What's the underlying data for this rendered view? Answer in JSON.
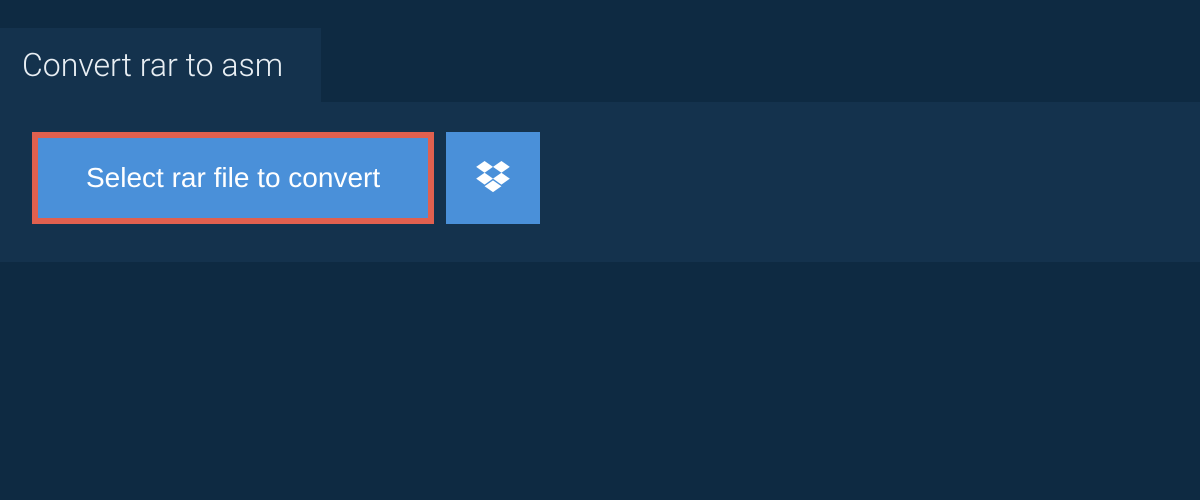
{
  "tab": {
    "title": "Convert rar to asm"
  },
  "actions": {
    "select_file_label": "Select rar file to convert"
  }
}
